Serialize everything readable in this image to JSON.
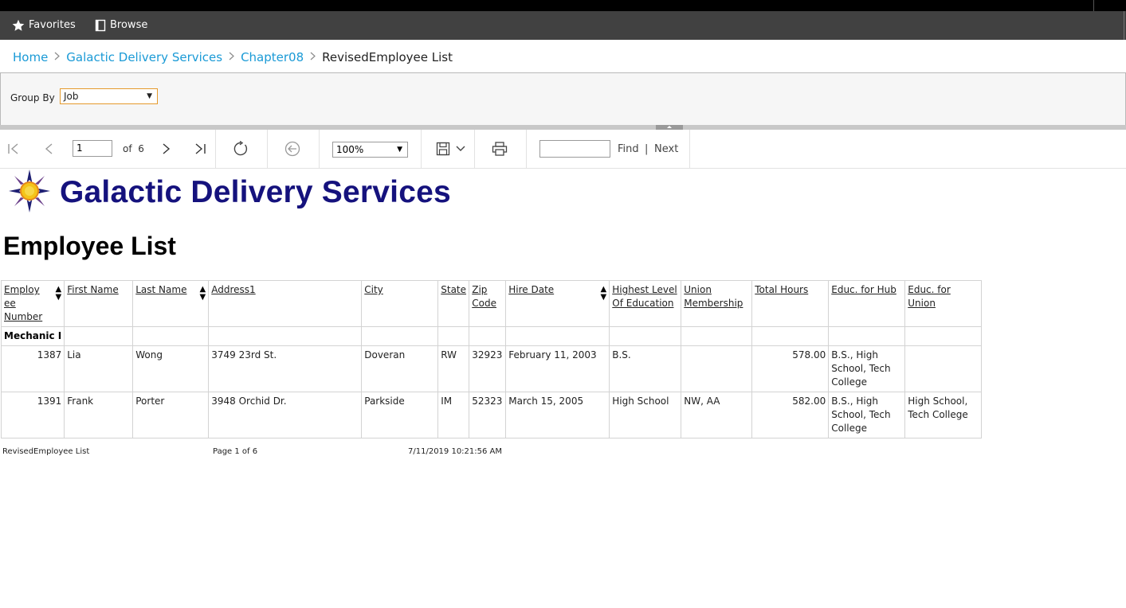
{
  "nav": {
    "favorites": "Favorites",
    "browse": "Browse"
  },
  "breadcrumb": {
    "items": [
      "Home",
      "Galactic Delivery Services",
      "Chapter08"
    ],
    "current": "RevisedEmployee List"
  },
  "parameters": {
    "group_by_label": "Group By",
    "group_by_value": "Job"
  },
  "toolbar": {
    "page_number": "1",
    "of_label": "of",
    "page_count": "6",
    "zoom": "100%",
    "find_label": "Find",
    "separator": "|",
    "next_label": "Next"
  },
  "report": {
    "company": "Galactic Delivery Services",
    "title": "Employee List",
    "columns": [
      "Employee Number",
      "First Name",
      "Last Name",
      "Address1",
      "City",
      "State",
      "Zip Code",
      "Hire Date",
      "Highest Level Of Education",
      "Union Membership",
      "Total Hours",
      "Educ. for Hub",
      "Educ. for Union"
    ],
    "group": "Mechanic I",
    "rows": [
      {
        "number": "1387",
        "first": "Lia",
        "last": "Wong",
        "address": "3749 23rd St.",
        "city": "Doveran",
        "state": "RW",
        "zip": "32923",
        "hire": "February 11, 2003",
        "education": "B.S.",
        "union": "",
        "hours": "578.00",
        "educ_hub": "B.S., High School, Tech College",
        "educ_union": ""
      },
      {
        "number": "1391",
        "first": "Frank",
        "last": "Porter",
        "address": "3948 Orchid Dr.",
        "city": "Parkside",
        "state": "IM",
        "zip": "52323",
        "hire": "March 15, 2005",
        "education": "High School",
        "union": "NW, AA",
        "hours": "582.00",
        "educ_hub": "B.S., High School, Tech College",
        "educ_union": "High School, Tech College"
      }
    ],
    "footer": {
      "name": "RevisedEmployee List",
      "page": "Page 1 of 6",
      "timestamp": "7/11/2019 10:21:56 AM"
    }
  },
  "colors": {
    "link": "#1a9ad6",
    "company": "#15127d",
    "navbar": "#414141",
    "select_border": "#e59a2c"
  }
}
